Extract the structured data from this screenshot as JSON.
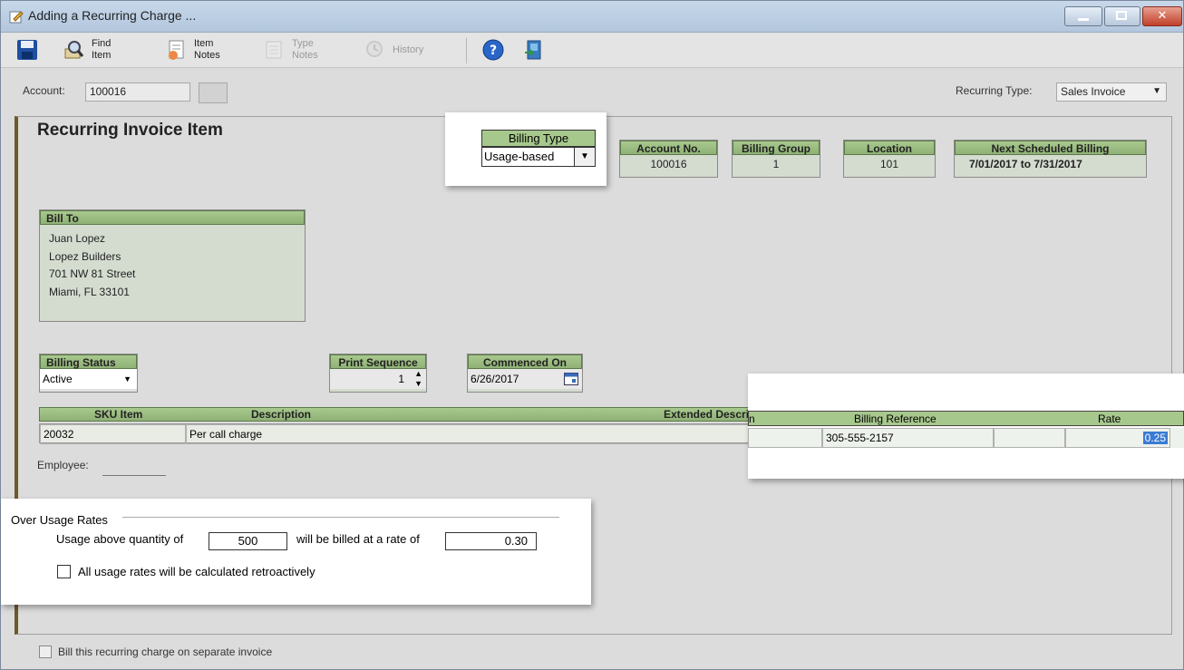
{
  "window": {
    "title": "Adding a Recurring Charge ..."
  },
  "toolbar": {
    "find_item": "Find\nItem",
    "item_notes": "Item\nNotes",
    "type_notes": "Type\nNotes",
    "history": "History"
  },
  "account": {
    "label": "Account:",
    "value": "100016"
  },
  "recurring_type": {
    "label": "Recurring Type:",
    "value": "Sales Invoice"
  },
  "heading": "Recurring Invoice Item",
  "billing_type": {
    "label": "Billing Type",
    "value": "Usage-based"
  },
  "account_no": {
    "label": "Account No.",
    "value": "100016"
  },
  "billing_group": {
    "label": "Billing Group",
    "value": "1"
  },
  "location": {
    "label": "Location",
    "value": "101"
  },
  "next_billing": {
    "label": "Next Scheduled Billing",
    "value": "7/01/2017 to 7/31/2017"
  },
  "bill_to": {
    "label": "Bill To",
    "lines": [
      "Juan Lopez",
      "Lopez Builders",
      "701 NW 81 Street",
      "Miami, FL 33101"
    ]
  },
  "billing_status": {
    "label": "Billing Status",
    "value": "Active"
  },
  "print_sequence": {
    "label": "Print Sequence",
    "value": "1"
  },
  "commenced_on": {
    "label": "Commenced On",
    "value": "6/26/2017"
  },
  "items_grid": {
    "headers": {
      "sku": "SKU Item",
      "description": "Description",
      "ext_desc": "Extended Description"
    },
    "row": {
      "sku": "20032",
      "description": "Per call charge"
    }
  },
  "employee": {
    "label": "Employee:"
  },
  "billing_ref_grid": {
    "header_partial": "n",
    "headers": {
      "billing_reference": "Billing Reference",
      "rate": "Rate"
    },
    "row": {
      "billing_reference": "305-555-2157",
      "rate": "0.25"
    }
  },
  "over_usage": {
    "title": "Over Usage Rates",
    "text_before": "Usage above quantity of",
    "quantity": "500",
    "text_middle": "will be billed at a rate of",
    "rate": "0.30",
    "retro_label": "All usage rates will be calculated retroactively"
  },
  "separate_invoice": {
    "label": "Bill this recurring charge on separate invoice"
  },
  "colors": {
    "grid_header_green": "#a7c88d",
    "panel_accent": "#6d5a2a",
    "selection_blue": "#3a7bd5"
  }
}
